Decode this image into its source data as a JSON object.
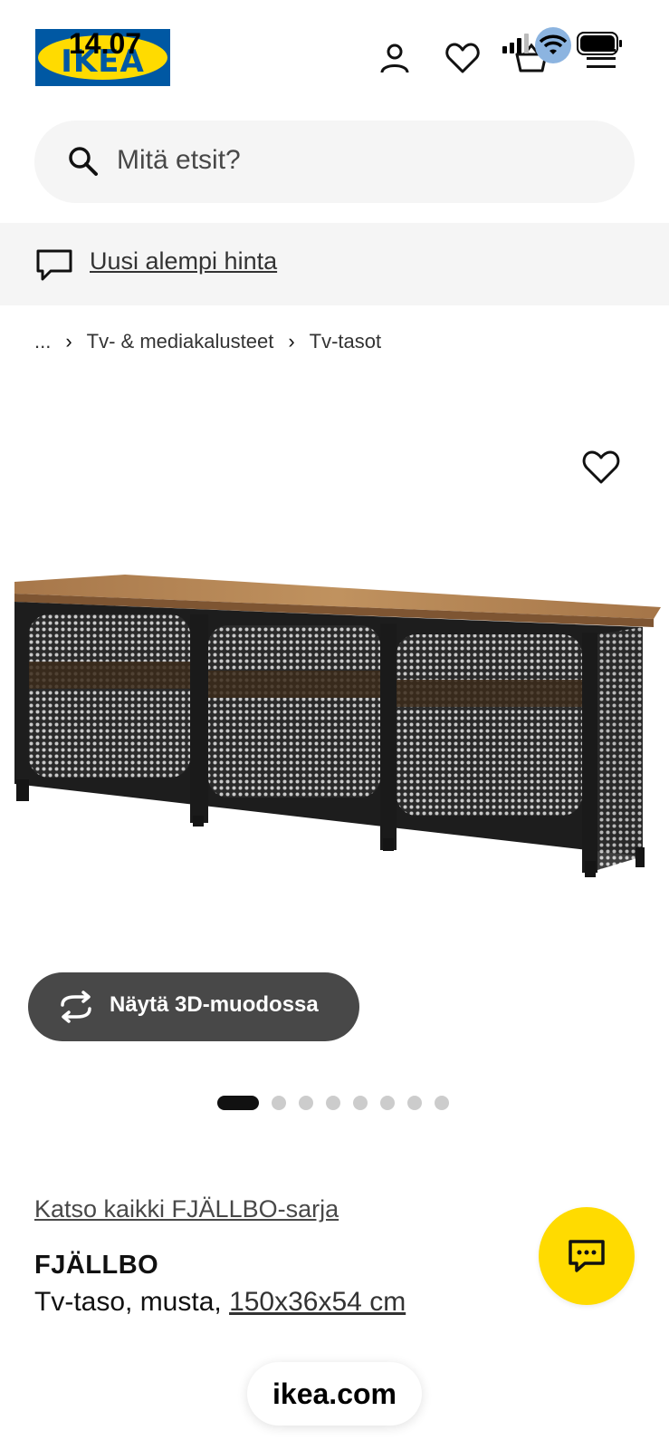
{
  "status_bar": {
    "time": "14.07"
  },
  "header": {
    "logo_text": "IKEA",
    "icons": [
      "person-icon",
      "heart-icon",
      "basket-icon",
      "menu-icon"
    ]
  },
  "search": {
    "placeholder": "Mitä etsit?"
  },
  "banner": {
    "link_text": "Uusi alempi hinta"
  },
  "breadcrumb": {
    "items": [
      "...",
      "Tv- & mediakalusteet",
      "Tv-tasot"
    ]
  },
  "gallery": {
    "button_label": "Näytä 3D-muodossa",
    "total_images": 8,
    "active_index": 0
  },
  "product": {
    "series_link": "Katso kaikki FJÄLLBO-sarja",
    "name": "FJÄLLBO",
    "description_prefix": "Tv-taso, musta, ",
    "dimensions": "150x36x54 cm"
  },
  "browser": {
    "url": "ikea.com"
  },
  "colors": {
    "ikea_blue": "#0058a3",
    "ikea_yellow": "#ffdb00",
    "button_dark": "#484848"
  }
}
